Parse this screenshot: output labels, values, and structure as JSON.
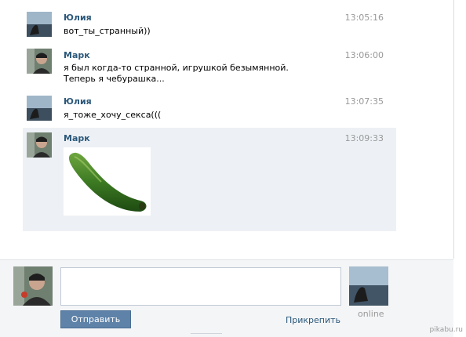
{
  "messages": [
    {
      "sender": "Юлия",
      "time": "13:05:16",
      "text": "вот_ты_странный))",
      "avatar": "woman-by-sea-avatar"
    },
    {
      "sender": "Марк",
      "time": "13:06:00",
      "text": "я был когда-то странной, игрушкой безымянной. Теперь я чебурашка...",
      "avatar": "man-avatar"
    },
    {
      "sender": "Юлия",
      "time": "13:07:35",
      "text": "я_тоже_хочу_секса(((",
      "avatar": "woman-by-sea-avatar"
    },
    {
      "sender": "Марк",
      "time": "13:09:33",
      "text": "",
      "avatar": "man-avatar",
      "attachment": "cucumber-image"
    }
  ],
  "compose": {
    "send_label": "Отправить",
    "attach_label": "Прикрепить",
    "status": "online"
  },
  "watermark": "pikabu.ru",
  "colors": {
    "name": "#2b587a",
    "time": "#999999",
    "button": "#5e82a8",
    "highlight": "#edf1f5"
  }
}
